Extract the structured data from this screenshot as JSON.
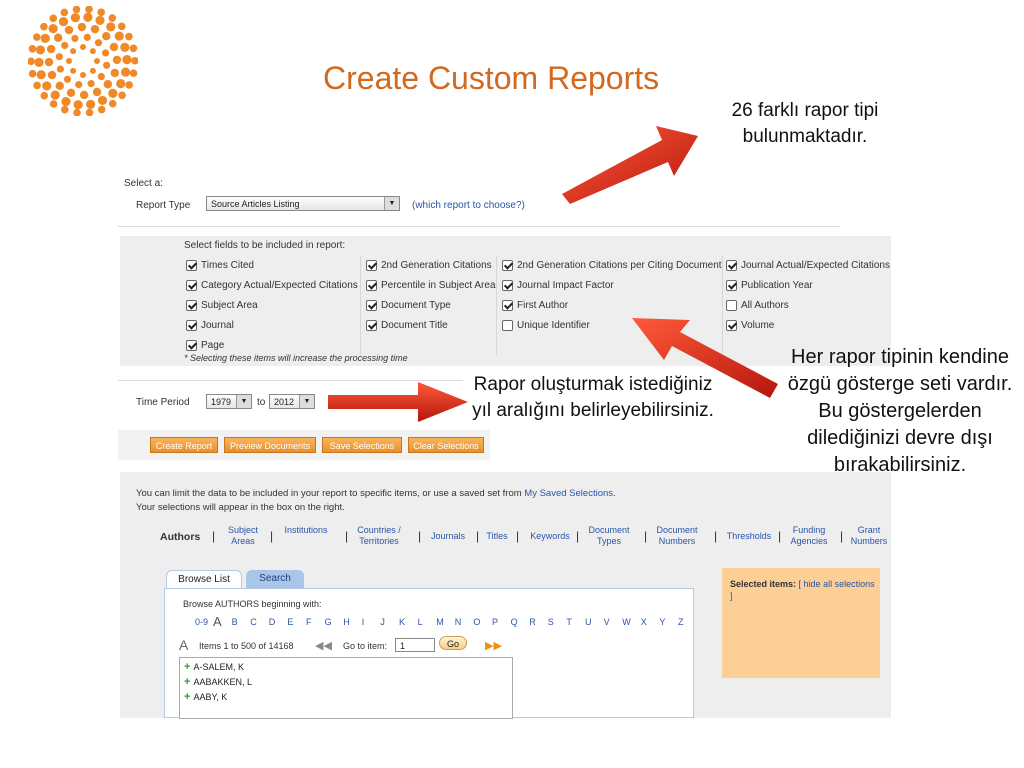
{
  "title": "Create Custom Reports",
  "callouts": {
    "report_types": "26 farklı rapor tipi bulunmaktadır.",
    "time_period": "Rapor oluşturmak istediğiniz yıl aralığını belirleyebilirsiniz.",
    "fields": "Her rapor tipinin kendine özgü gösterge seti vardır. Bu göstergelerden dilediğinizi devre dışı bırakabilirsiniz."
  },
  "report_select": {
    "select_label": "Select a:",
    "report_type_label": "Report Type",
    "report_type_value": "Source Articles Listing",
    "help_link": "(which report to choose?)"
  },
  "fields": {
    "heading": "Select fields to be included in report:",
    "note": "* Selecting these items will increase the processing time",
    "items": [
      {
        "label": "Times Cited",
        "checked": true
      },
      {
        "label": "2nd Generation Citations",
        "checked": true
      },
      {
        "label": "2nd Generation Citations per Citing Document",
        "checked": true
      },
      {
        "label": "Journal Actual/Expected Citations",
        "checked": true
      },
      {
        "label": "Category Actual/Expected Citations",
        "checked": true
      },
      {
        "label": "Percentile in Subject Area",
        "checked": true
      },
      {
        "label": "Journal Impact Factor",
        "checked": true
      },
      {
        "label": "Publication Year",
        "checked": true
      },
      {
        "label": "Subject Area",
        "checked": true
      },
      {
        "label": "Document Type",
        "checked": true
      },
      {
        "label": "First Author",
        "checked": true
      },
      {
        "label": "All Authors",
        "checked": false
      },
      {
        "label": "Journal",
        "checked": true
      },
      {
        "label": "Document Title",
        "checked": true
      },
      {
        "label": "Unique Identifier",
        "checked": false
      },
      {
        "label": "Volume",
        "checked": true
      },
      {
        "label": "Page",
        "checked": true
      }
    ]
  },
  "time_period": {
    "label": "Time Period",
    "from": "1979",
    "to_label": "to",
    "to": "2012"
  },
  "buttons": {
    "create_report": "Create Report",
    "preview_documents": "Preview Documents",
    "save_selections": "Save Selections",
    "clear_selections": "Clear Selections"
  },
  "limit": {
    "line1_pre": "You can limit the data to be included in your report to specific items, or use a saved set from",
    "line1_link": "My Saved Selections",
    "line1_post": ".",
    "line2": "Your selections will appear in the box on the right."
  },
  "category_tabs": {
    "active": "Authors",
    "items": [
      "Subject Areas",
      "Institutions",
      "Countries / Territories",
      "Journals",
      "Titles",
      "Keywords",
      "Document Types",
      "Document Numbers",
      "Thresholds",
      "Funding Agencies",
      "Grant Numbers"
    ]
  },
  "browse": {
    "tab_browse": "Browse List",
    "tab_search": "Search",
    "heading": "Browse AUTHORS beginning with:",
    "letters": [
      "0-9",
      "A",
      "B",
      "C",
      "D",
      "E",
      "F",
      "G",
      "H",
      "I",
      "J",
      "K",
      "L",
      "M",
      "N",
      "O",
      "P",
      "Q",
      "R",
      "S",
      "T",
      "U",
      "V",
      "W",
      "X",
      "Y",
      "Z"
    ],
    "current_letter": "A",
    "items_range": "Items 1 to 500 of 14168",
    "go_to_label": "Go to item:",
    "go_to_value": "1",
    "go_button": "Go",
    "authors": [
      "A-SALEM, K",
      "AABAKKEN, L",
      "AABY, K"
    ]
  },
  "selected": {
    "label": "Selected items:",
    "hide_link": "[ hide all selections ]"
  },
  "colors": {
    "title": "#d2691e",
    "arrow": "#e0261b",
    "button_orange": "#f0a040",
    "selected_panel": "#fbcf95",
    "link_blue": "#2a55a8"
  }
}
